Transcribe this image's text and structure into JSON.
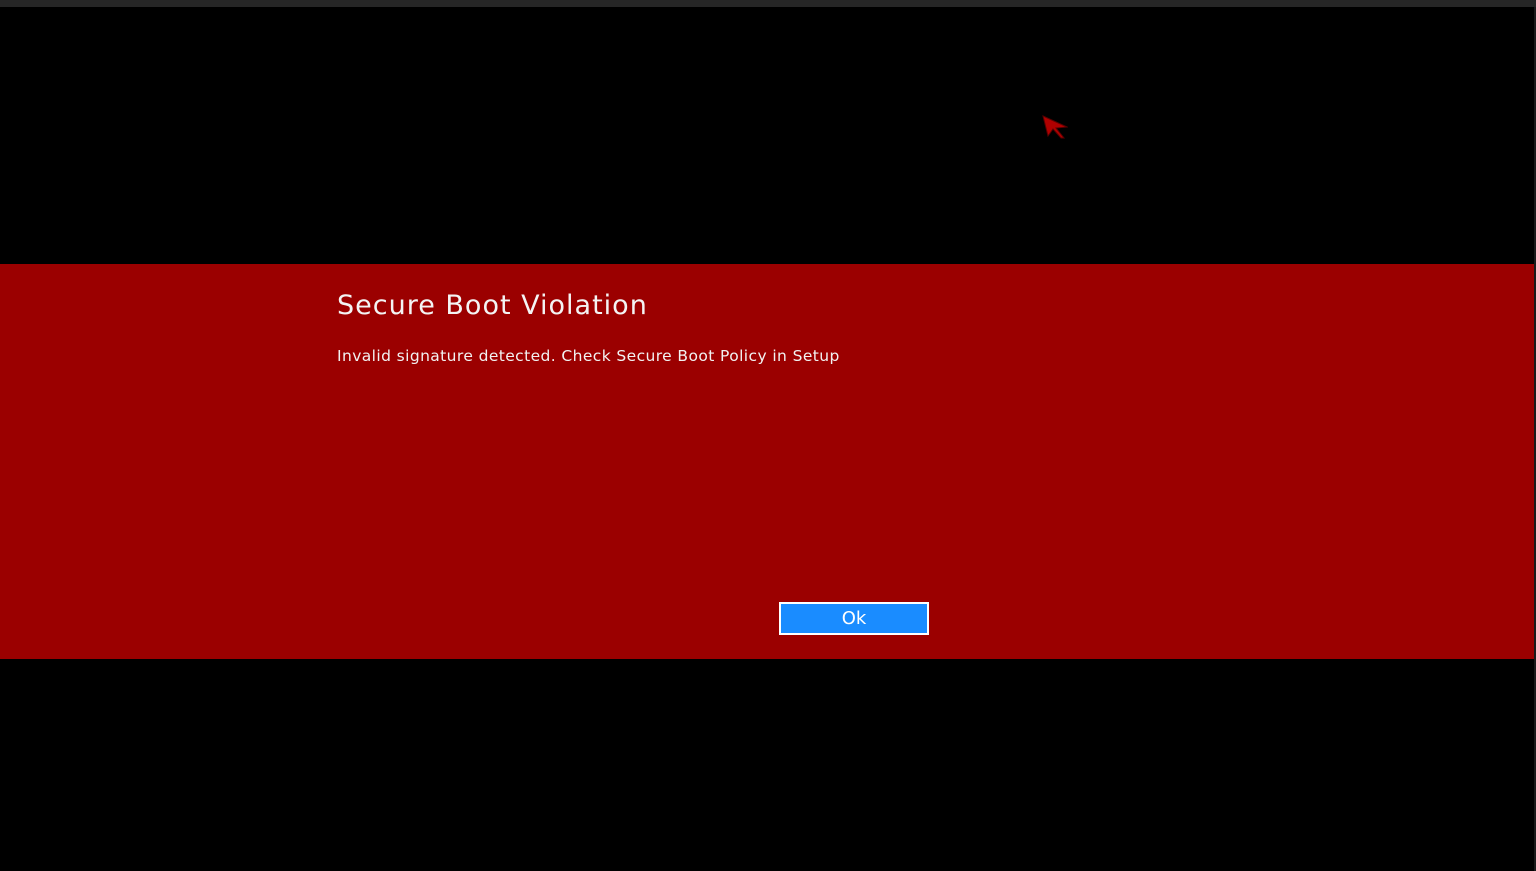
{
  "dialog": {
    "title": "Secure Boot Violation",
    "message": "Invalid signature detected. Check Secure Boot Policy in Setup",
    "ok_label": "Ok"
  },
  "colors": {
    "background": "#000000",
    "dialog_band": "#9b0000",
    "button_fill": "#1a8cff",
    "button_border": "#ffffff",
    "text": "#f4f4f4",
    "cursor": "#b00000"
  },
  "icons": {
    "cursor": "mouse-pointer-icon"
  }
}
